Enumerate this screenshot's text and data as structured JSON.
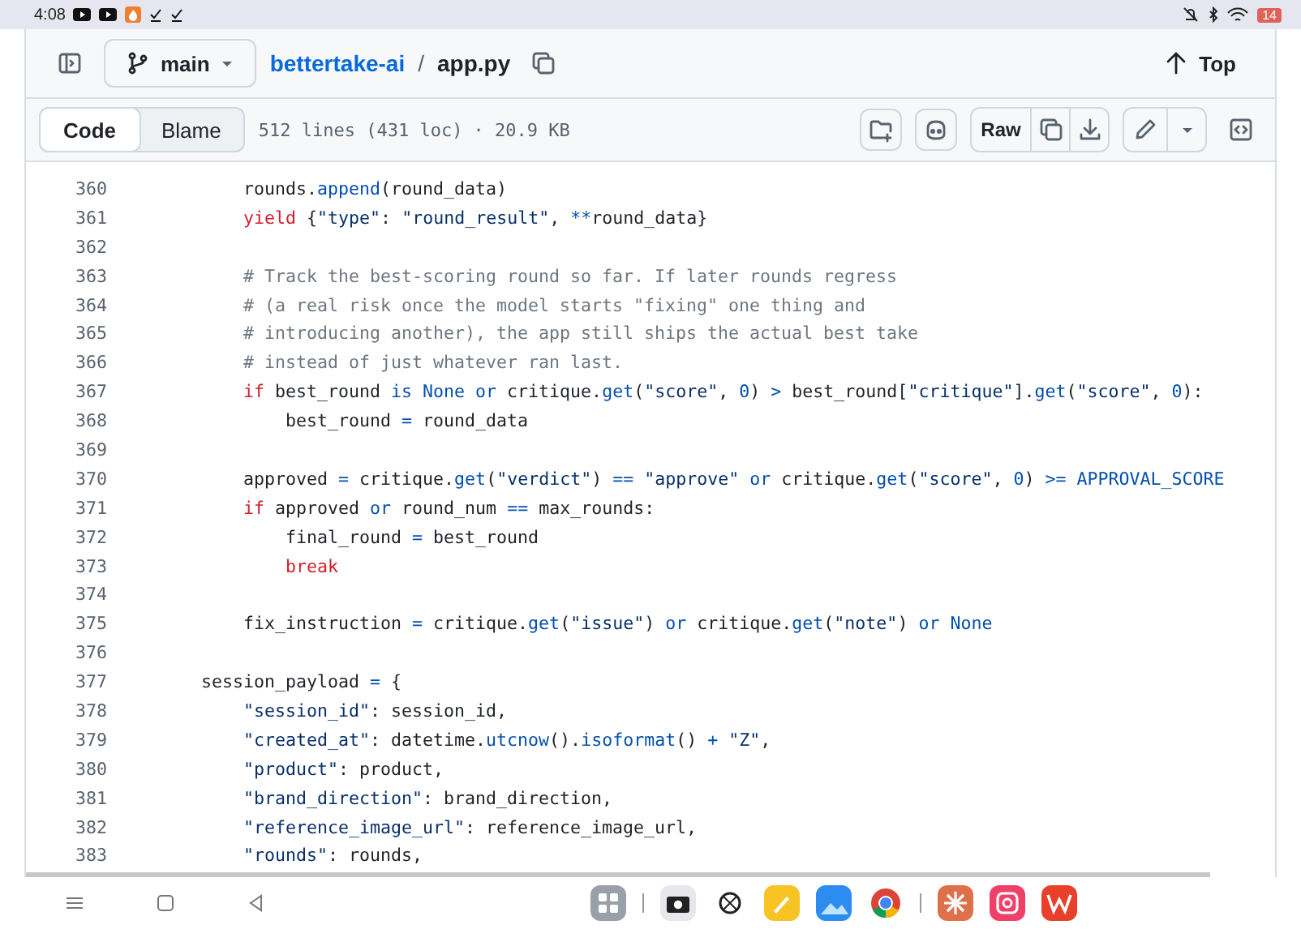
{
  "status_bar": {
    "time": "4:08",
    "battery": "14"
  },
  "header": {
    "branch": "main",
    "repo": "bettertake-ai",
    "separator": "/",
    "file": "app.py",
    "top_label": "Top"
  },
  "toolbar": {
    "tabs": [
      {
        "label": "Code",
        "selected": true
      },
      {
        "label": "Blame",
        "selected": false
      }
    ],
    "file_info": "512 lines (431 loc) · 20.9 KB",
    "raw_label": "Raw"
  },
  "code_lines": [
    {
      "children": [
        {
          "number": "360",
          "tokens": [
            {
              "kind": "plain",
              "text": "rounds."
            },
            {
              "kind": "func",
              "text": "append"
            },
            {
              "kind": "plain",
              "text": "(round_data)"
            }
          ]
        },
        {
          "number": "361",
          "tokens": [
            {
              "kind": "keyword",
              "text": "yield"
            },
            {
              "kind": "plain",
              "text": " {"
            },
            {
              "kind": "string",
              "text": "\"type\""
            },
            {
              "kind": "plain",
              "text": ": "
            },
            {
              "kind": "string",
              "text": "\"round_result\""
            },
            {
              "kind": "plain",
              "text": ", "
            },
            {
              "kind": "operator",
              "text": "**"
            },
            {
              "kind": "plain",
              "text": "round_data}"
            }
          ]
        },
        {
          "number": "362"
        },
        {
          "number": "363",
          "tokens": [
            {
              "kind": "comment",
              "text": "# Track the best-scoring round so far. If later rounds regress"
            }
          ]
        },
        {
          "number": "364",
          "tokens": [
            {
              "kind": "comment",
              "text": "# (a real risk once the model starts \"fixing\" one thing and"
            }
          ]
        },
        {
          "number": "365",
          "tokens": [
            {
              "kind": "comment",
              "text": "# introducing another), the app still ships the actual best take"
            }
          ]
        },
        {
          "number": "366",
          "tokens": [
            {
              "kind": "comment",
              "text": "# instead of just whatever ran last."
            }
          ]
        },
        {
          "number": "367",
          "tokens": [
            {
              "kind": "keyword",
              "text": "if"
            },
            {
              "kind": "plain",
              "text": " best_round "
            },
            {
              "kind": "operator",
              "text": "is None or"
            },
            {
              "kind": "plain",
              "text": " critique."
            },
            {
              "kind": "func",
              "text": "get"
            },
            {
              "kind": "plain",
              "text": "("
            },
            {
              "kind": "string",
              "text": "\"score\""
            },
            {
              "kind": "plain",
              "text": ", "
            },
            {
              "kind": "operator",
              "text": "0"
            },
            {
              "kind": "plain",
              "text": ") "
            },
            {
              "kind": "operator",
              "text": ">"
            },
            {
              "kind": "plain",
              "text": " best_round["
            },
            {
              "kind": "string",
              "text": "\"critique\""
            },
            {
              "kind": "plain",
              "text": "]."
            },
            {
              "kind": "func",
              "text": "get"
            },
            {
              "kind": "plain",
              "text": "("
            },
            {
              "kind": "string",
              "text": "\"score\""
            },
            {
              "kind": "plain",
              "text": ", "
            },
            {
              "kind": "operator",
              "text": "0"
            },
            {
              "kind": "plain",
              "text": "):"
            }
          ],
          "children": [
            {
              "number": "368",
              "tokens": [
                {
                  "kind": "plain",
                  "text": "best_round "
                },
                {
                  "kind": "operator",
                  "text": "="
                },
                {
                  "kind": "plain",
                  "text": " round_data"
                }
              ]
            }
          ]
        },
        {
          "number": "369"
        },
        {
          "number": "370",
          "tokens": [
            {
              "kind": "plain",
              "text": "approved "
            },
            {
              "kind": "operator",
              "text": "="
            },
            {
              "kind": "plain",
              "text": " critique."
            },
            {
              "kind": "func",
              "text": "get"
            },
            {
              "kind": "plain",
              "text": "("
            },
            {
              "kind": "string",
              "text": "\"verdict\""
            },
            {
              "kind": "plain",
              "text": ") "
            },
            {
              "kind": "operator",
              "text": "=="
            },
            {
              "kind": "string",
              "text": " \"approve\" "
            },
            {
              "kind": "operator",
              "text": "or"
            },
            {
              "kind": "plain",
              "text": " critique."
            },
            {
              "kind": "func",
              "text": "get"
            },
            {
              "kind": "plain",
              "text": "("
            },
            {
              "kind": "string",
              "text": "\"score\""
            },
            {
              "kind": "plain",
              "text": ", "
            },
            {
              "kind": "operator",
              "text": "0"
            },
            {
              "kind": "plain",
              "text": ") "
            },
            {
              "kind": "operator",
              "text": ">= APPROVAL_SCORE"
            }
          ]
        },
        {
          "number": "371",
          "tokens": [
            {
              "kind": "keyword",
              "text": "if"
            },
            {
              "kind": "plain",
              "text": " approved "
            },
            {
              "kind": "operator",
              "text": "or"
            },
            {
              "kind": "plain",
              "text": " round_num "
            },
            {
              "kind": "operator",
              "text": "=="
            },
            {
              "kind": "plain",
              "text": " max_rounds:"
            }
          ],
          "children": [
            {
              "number": "372",
              "tokens": [
                {
                  "kind": "plain",
                  "text": "final_round "
                },
                {
                  "kind": "operator",
                  "text": "="
                },
                {
                  "kind": "plain",
                  "text": " best_round"
                }
              ]
            },
            {
              "number": "373",
              "tokens": [
                {
                  "kind": "keyword",
                  "text": "break"
                }
              ]
            }
          ]
        },
        {
          "number": "374"
        },
        {
          "number": "375",
          "tokens": [
            {
              "kind": "plain",
              "text": "fix_instruction "
            },
            {
              "kind": "operator",
              "text": "="
            },
            {
              "kind": "plain",
              "text": " critique."
            },
            {
              "kind": "func",
              "text": "get"
            },
            {
              "kind": "plain",
              "text": "("
            },
            {
              "kind": "string",
              "text": "\"issue\""
            },
            {
              "kind": "plain",
              "text": ") "
            },
            {
              "kind": "operator",
              "text": "or"
            },
            {
              "kind": "plain",
              "text": " critique."
            },
            {
              "kind": "func",
              "text": "get"
            },
            {
              "kind": "plain",
              "text": "("
            },
            {
              "kind": "string",
              "text": "\"note\""
            },
            {
              "kind": "plain",
              "text": ") "
            },
            {
              "kind": "operator",
              "text": "or None"
            }
          ]
        },
        {
          "number": "376"
        }
      ]
    },
    {
      "number": "377",
      "tokens": [
        {
          "kind": "plain",
          "text": "session_payload "
        },
        {
          "kind": "operator",
          "text": "="
        },
        {
          "kind": "plain",
          "text": " {"
        }
      ],
      "children": [
        {
          "number": "378",
          "tokens": [
            {
              "kind": "string",
              "text": "\"session_id\""
            },
            {
              "kind": "plain",
              "text": ": session_id,"
            }
          ]
        },
        {
          "number": "379",
          "tokens": [
            {
              "kind": "string",
              "text": "\"created_at\""
            },
            {
              "kind": "plain",
              "text": ": datetime."
            },
            {
              "kind": "func",
              "text": "utcnow"
            },
            {
              "kind": "plain",
              "text": "()."
            },
            {
              "kind": "func",
              "text": "isoformat"
            },
            {
              "kind": "plain",
              "text": "() "
            },
            {
              "kind": "operator",
              "text": "+"
            },
            {
              "kind": "string",
              "text": " \"Z\""
            },
            {
              "kind": "plain",
              "text": ","
            }
          ]
        },
        {
          "number": "380",
          "tokens": [
            {
              "kind": "string",
              "text": "\"product\""
            },
            {
              "kind": "plain",
              "text": ": product,"
            }
          ]
        },
        {
          "number": "381",
          "tokens": [
            {
              "kind": "string",
              "text": "\"brand_direction\""
            },
            {
              "kind": "plain",
              "text": ": brand_direction,"
            }
          ]
        },
        {
          "number": "382",
          "tokens": [
            {
              "kind": "string",
              "text": "\"reference_image_url\""
            },
            {
              "kind": "plain",
              "text": ": reference_image_url,"
            }
          ]
        },
        {
          "number": "383",
          "tokens": [
            {
              "kind": "string",
              "text": "\"rounds\""
            },
            {
              "kind": "plain",
              "text": ": rounds,"
            }
          ]
        }
      ]
    }
  ]
}
